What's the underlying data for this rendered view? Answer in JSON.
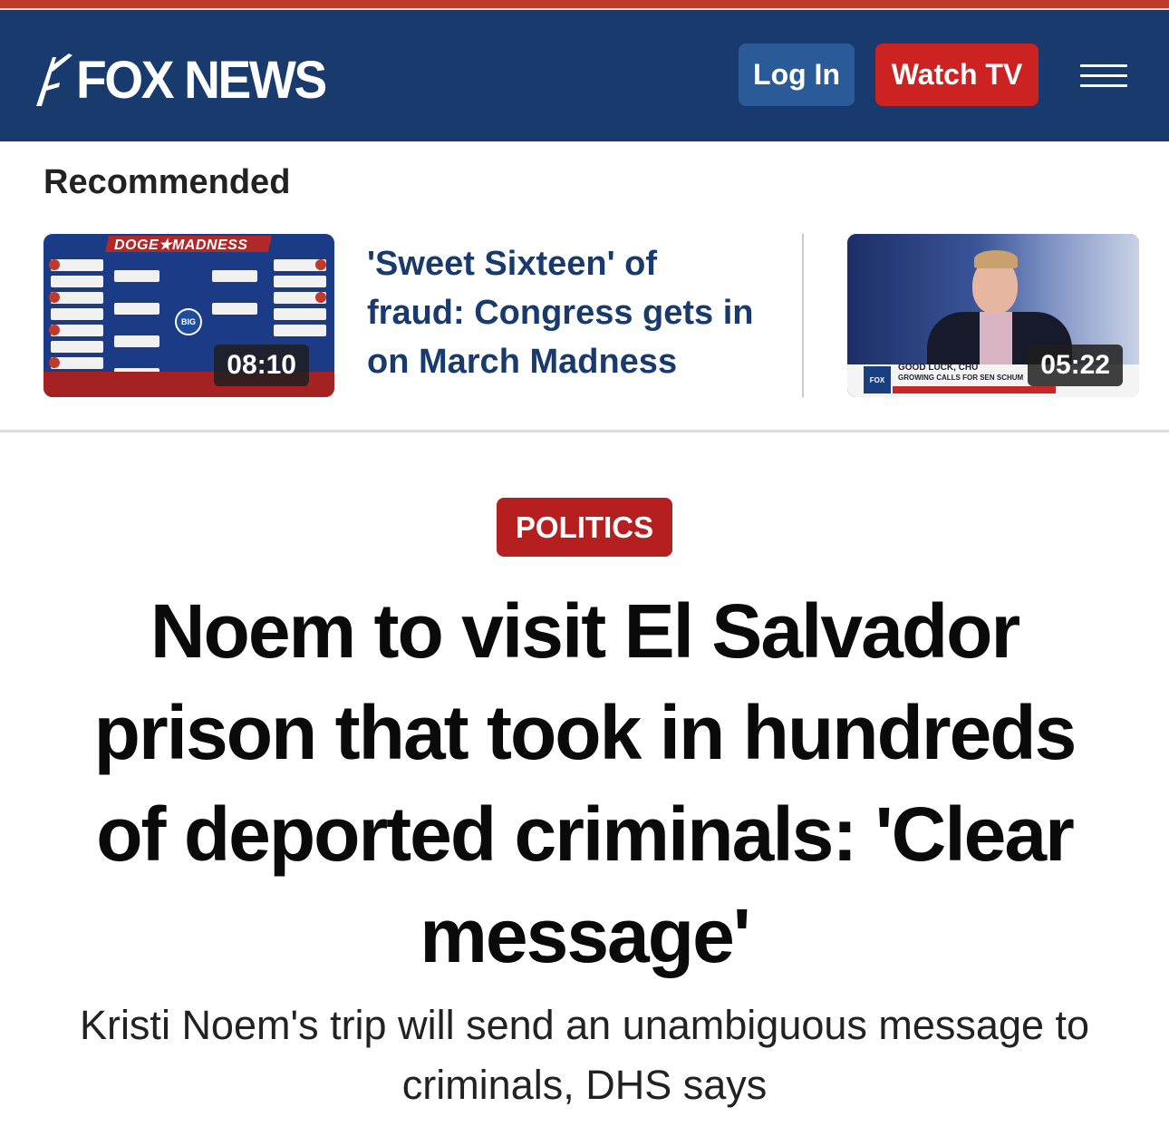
{
  "header": {
    "logo_text": "FOX NEWS",
    "login_label": "Log In",
    "watch_label": "Watch TV",
    "menu_icon": "hamburger-menu-icon",
    "colors": {
      "bar": "#183a6d",
      "login": "#2a5b98",
      "watch": "#cc2222",
      "accent_stripe": "#c0392b"
    }
  },
  "recommended": {
    "title": "Recommended",
    "items": [
      {
        "duration": "08:10",
        "headline": "'Sweet Sixteen' of fraud: Congress gets in on March Madness",
        "banner": "DOGE★MADNESS",
        "show_logo": "BIG"
      },
      {
        "duration": "05:22",
        "lower_third": "GOOD LUCK, CHU",
        "lower_third_sub": "GROWING CALLS FOR SEN SCHUM"
      }
    ]
  },
  "article": {
    "category": "POLITICS",
    "headline": "Noem to visit El Salvador prison that took in hundreds of deported criminals: 'Clear message'",
    "subheadline": "Kristi Noem's trip will send an unambiguous message to criminals, DHS says"
  }
}
